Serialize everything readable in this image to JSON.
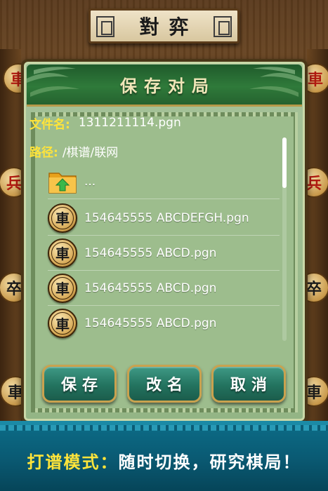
{
  "header": {
    "title": "對弈"
  },
  "dialog": {
    "title": "保存对局",
    "file_name_label": "文件名:",
    "file_name_value": "1311211114.pgn",
    "path_label": "路径:",
    "path_value": "/棋谱/联网",
    "parent_folder_label": "...",
    "files": [
      {
        "icon": "chess-piece-icon",
        "glyph": "車",
        "name": "154645555 ABCDEFGH.pgn"
      },
      {
        "icon": "chess-piece-icon",
        "glyph": "車",
        "name": "154645555 ABCD.pgn"
      },
      {
        "icon": "chess-piece-icon",
        "glyph": "車",
        "name": "154645555 ABCD.pgn"
      },
      {
        "icon": "chess-piece-icon",
        "glyph": "車",
        "name": "154645555 ABCD.pgn"
      }
    ],
    "buttons": {
      "save": "保存",
      "rename": "改名",
      "cancel": "取消"
    }
  },
  "side_pieces": {
    "left": [
      "車",
      "兵",
      "卒",
      "車"
    ],
    "right": [
      "車",
      "兵",
      "卒",
      "車"
    ]
  },
  "banner": {
    "highlight": "打谱模式：",
    "rest": "随时切换，研究棋局！"
  },
  "colors": {
    "accent_yellow": "#ffe43a",
    "dialog_header_green": "#2f7a3a",
    "button_teal": "#23735f",
    "banner_blue": "#0a5a73"
  }
}
